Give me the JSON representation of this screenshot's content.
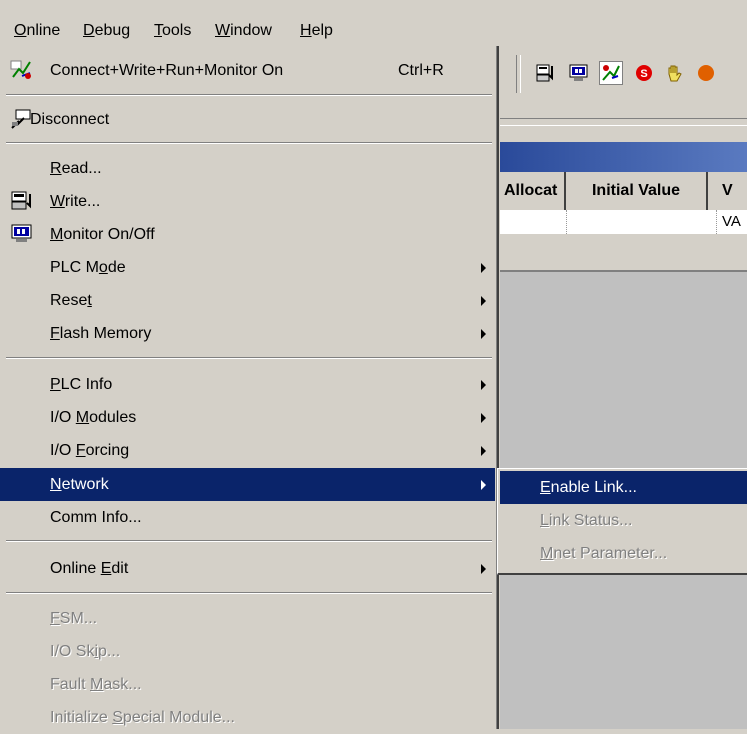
{
  "menubar": {
    "items": [
      {
        "label": "Online",
        "mn": "O",
        "rest": "nline"
      },
      {
        "label": "Debug",
        "mn": "D",
        "rest": "ebug"
      },
      {
        "label": "Tools",
        "mn": "T",
        "rest": "ools"
      },
      {
        "label": "Window",
        "mn": "W",
        "rest": "indow"
      },
      {
        "label": "Help",
        "mn": "H",
        "rest": "elp"
      }
    ]
  },
  "grid": {
    "headers": [
      "Allocat",
      "Initial Value",
      "V"
    ],
    "row": [
      "",
      "",
      "VA"
    ]
  },
  "menu": {
    "connect": {
      "label": "Connect+Write+Run+Monitor On",
      "shortcut": "Ctrl+R"
    },
    "disconnect": {
      "label": "Disconnect"
    },
    "read": {
      "mn": "R",
      "rest": "ead..."
    },
    "write": {
      "mn": "W",
      "rest": "rite..."
    },
    "monitor": {
      "mn": "M",
      "rest": "onitor On/Off"
    },
    "plc_mode": {
      "pre": "PLC M",
      "mn": "o",
      "rest": "de"
    },
    "reset": {
      "pre": "Rese",
      "mn": "t",
      "rest": ""
    },
    "flash": {
      "mn": "F",
      "rest": "lash Memory"
    },
    "plc_info": {
      "mn": "P",
      "rest": "LC Info"
    },
    "io_modules": {
      "pre": "I/O ",
      "mn": "M",
      "rest": "odules"
    },
    "io_forcing": {
      "pre": "I/O ",
      "mn": "F",
      "rest": "orcing"
    },
    "network": {
      "mn": "N",
      "rest": "etwork"
    },
    "comm_info": {
      "label": "Comm Info..."
    },
    "online_edit": {
      "pre": "Online ",
      "mn": "E",
      "rest": "dit"
    },
    "fsm": {
      "mn": "F",
      "rest": "SM..."
    },
    "io_skip": {
      "pre": "I/O Sk",
      "mn": "i",
      "rest": "p..."
    },
    "fault_mask": {
      "pre": "Fault ",
      "mn": "M",
      "rest": "ask..."
    },
    "init_special": {
      "pre": "Initialize ",
      "mn": "S",
      "rest": "pecial Module..."
    }
  },
  "submenu": {
    "enable_link": {
      "mn": "E",
      "rest": "nable Link..."
    },
    "link_status": {
      "mn": "L",
      "rest": "ink Status..."
    },
    "mnet_param": {
      "mn": "M",
      "rest": "net Parameter..."
    }
  },
  "colors": {
    "highlight": "#0a246a",
    "menu_bg": "#d4d0c8",
    "disabled": "#808080"
  }
}
